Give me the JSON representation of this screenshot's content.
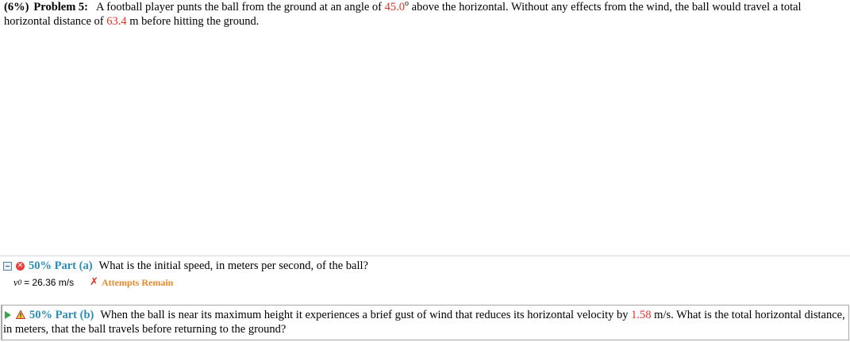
{
  "problem": {
    "percent": "(6%)",
    "title": "Problem 5:",
    "text_1": "A football player punts the ball from the ground at an angle of ",
    "angle": "45.0",
    "degree": "o",
    "text_2": " above the horizontal. Without any effects from the wind, the ball would travel a total horizontal distance of ",
    "distance": "63.4",
    "distance_unit": " m",
    "text_3": " before hitting the ground."
  },
  "part_a": {
    "label": "50% Part (a)",
    "question": "What is the initial speed, in meters per second, of the ball?",
    "answer_var": "v",
    "answer_sub": "0",
    "answer_value": " = 26.36 m/s",
    "attempts_text": "Attempts Remain",
    "attempts_mark": "✗"
  },
  "part_b": {
    "label": "50% Part (b)",
    "text_1": "When the ball is near its maximum height it experiences a brief gust of wind that reduces its horizontal velocity by ",
    "velocity": "1.58",
    "velocity_unit": " m/s",
    "text_2": ". What is the total horizontal distance, in meters, that the ball travels before returning to the ground?"
  },
  "colors": {
    "highlight_red": "#e8312a",
    "part_label_blue": "#2a8cb8",
    "attempts_orange": "#e8892a",
    "play_green": "#3fa34a"
  }
}
